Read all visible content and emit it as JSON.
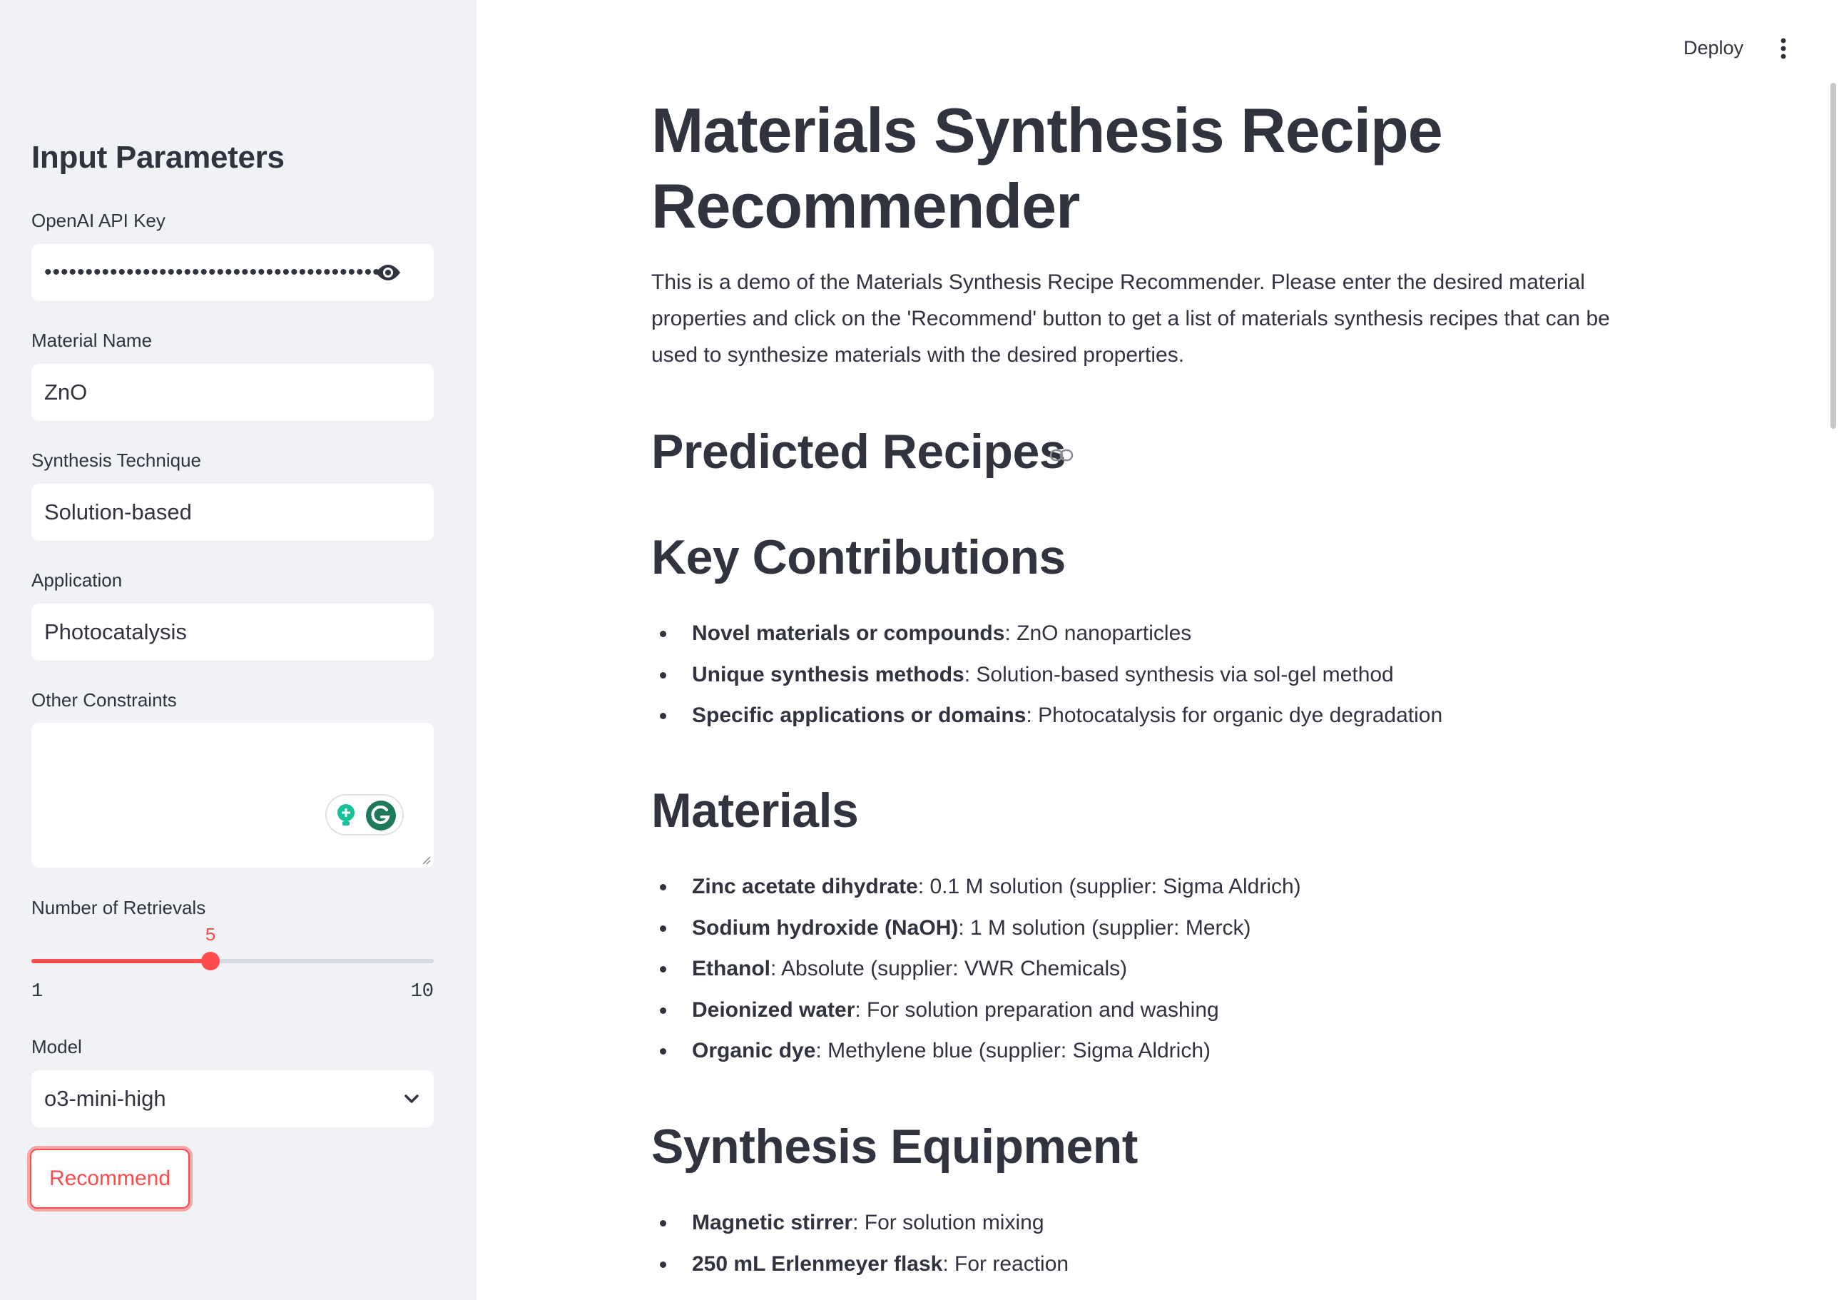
{
  "sidebar": {
    "heading": "Input Parameters",
    "api_key": {
      "label": "OpenAI API Key",
      "value": "••••••••••••••••••••••••••••••••••••••••••••"
    },
    "material_name": {
      "label": "Material Name",
      "value": "ZnO"
    },
    "synthesis_technique": {
      "label": "Synthesis Technique",
      "value": "Solution-based"
    },
    "application": {
      "label": "Application",
      "value": "Photocatalysis"
    },
    "other_constraints": {
      "label": "Other Constraints",
      "value": ""
    },
    "retrievals": {
      "label": "Number of Retrievals",
      "value": 5,
      "min": 1,
      "max": 10
    },
    "model": {
      "label": "Model",
      "value": "o3-mini-high"
    },
    "recommend_label": "Recommend"
  },
  "topbar": {
    "deploy_label": "Deploy"
  },
  "main": {
    "title": "Materials Synthesis Recipe Recommender",
    "intro": "This is a demo of the Materials Synthesis Recipe Recommender. Please enter the desired material properties and click on the 'Recommend' button to get a list of materials synthesis recipes that can be used to synthesize materials with the desired properties.",
    "predicted_heading": "Predicted Recipes",
    "key_contributions": {
      "heading": "Key Contributions",
      "items": [
        {
          "term": "Novel materials or compounds",
          "desc": ": ZnO nanoparticles"
        },
        {
          "term": "Unique synthesis methods",
          "desc": ": Solution-based synthesis via sol-gel method"
        },
        {
          "term": "Specific applications or domains",
          "desc": ": Photocatalysis for organic dye degradation"
        }
      ]
    },
    "materials": {
      "heading": "Materials",
      "items": [
        {
          "term": "Zinc acetate dihydrate",
          "desc": ": 0.1 M solution (supplier: Sigma Aldrich)"
        },
        {
          "term": "Sodium hydroxide (NaOH)",
          "desc": ": 1 M solution (supplier: Merck)"
        },
        {
          "term": "Ethanol",
          "desc": ": Absolute (supplier: VWR Chemicals)"
        },
        {
          "term": "Deionized water",
          "desc": ": For solution preparation and washing"
        },
        {
          "term": "Organic dye",
          "desc": ": Methylene blue (supplier: Sigma Aldrich)"
        }
      ]
    },
    "equipment": {
      "heading": "Synthesis Equipment",
      "items": [
        {
          "term": "Magnetic stirrer",
          "desc": ": For solution mixing"
        },
        {
          "term": "250 mL Erlenmeyer flask",
          "desc": ": For reaction"
        }
      ]
    }
  },
  "colors": {
    "accent": "#ff4b4b",
    "sidebar_bg": "#f0f2f6",
    "text": "#31333f"
  },
  "icons": [
    "eye-icon",
    "grammarly-bulb-icon",
    "grammarly-g-icon",
    "chevron-down-icon",
    "kebab-menu-icon",
    "link-icon"
  ]
}
